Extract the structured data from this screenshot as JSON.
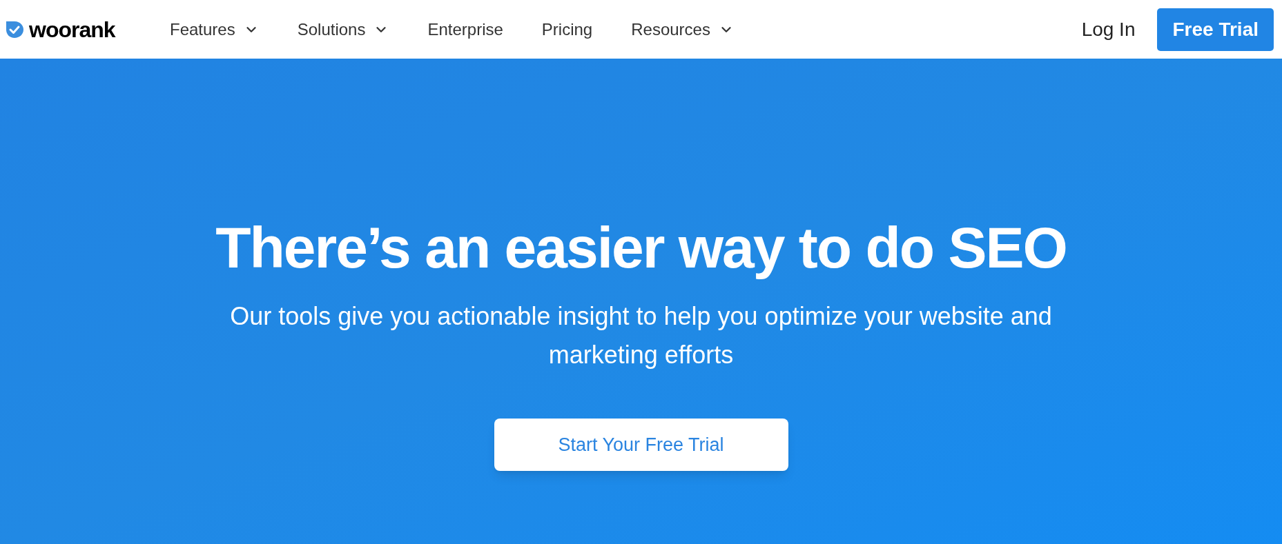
{
  "logo": {
    "text": "woorank"
  },
  "nav": [
    {
      "label": "Features",
      "dropdown": true
    },
    {
      "label": "Solutions",
      "dropdown": true
    },
    {
      "label": "Enterprise",
      "dropdown": false
    },
    {
      "label": "Pricing",
      "dropdown": false
    },
    {
      "label": "Resources",
      "dropdown": true
    }
  ],
  "login": "Log In",
  "trial_button": "Free Trial",
  "hero": {
    "title": "There’s an easier way to do SEO",
    "subtitle": "Our tools give you actionable insight to help you optimize your website and marketing efforts",
    "cta": "Start Your Free Trial"
  }
}
